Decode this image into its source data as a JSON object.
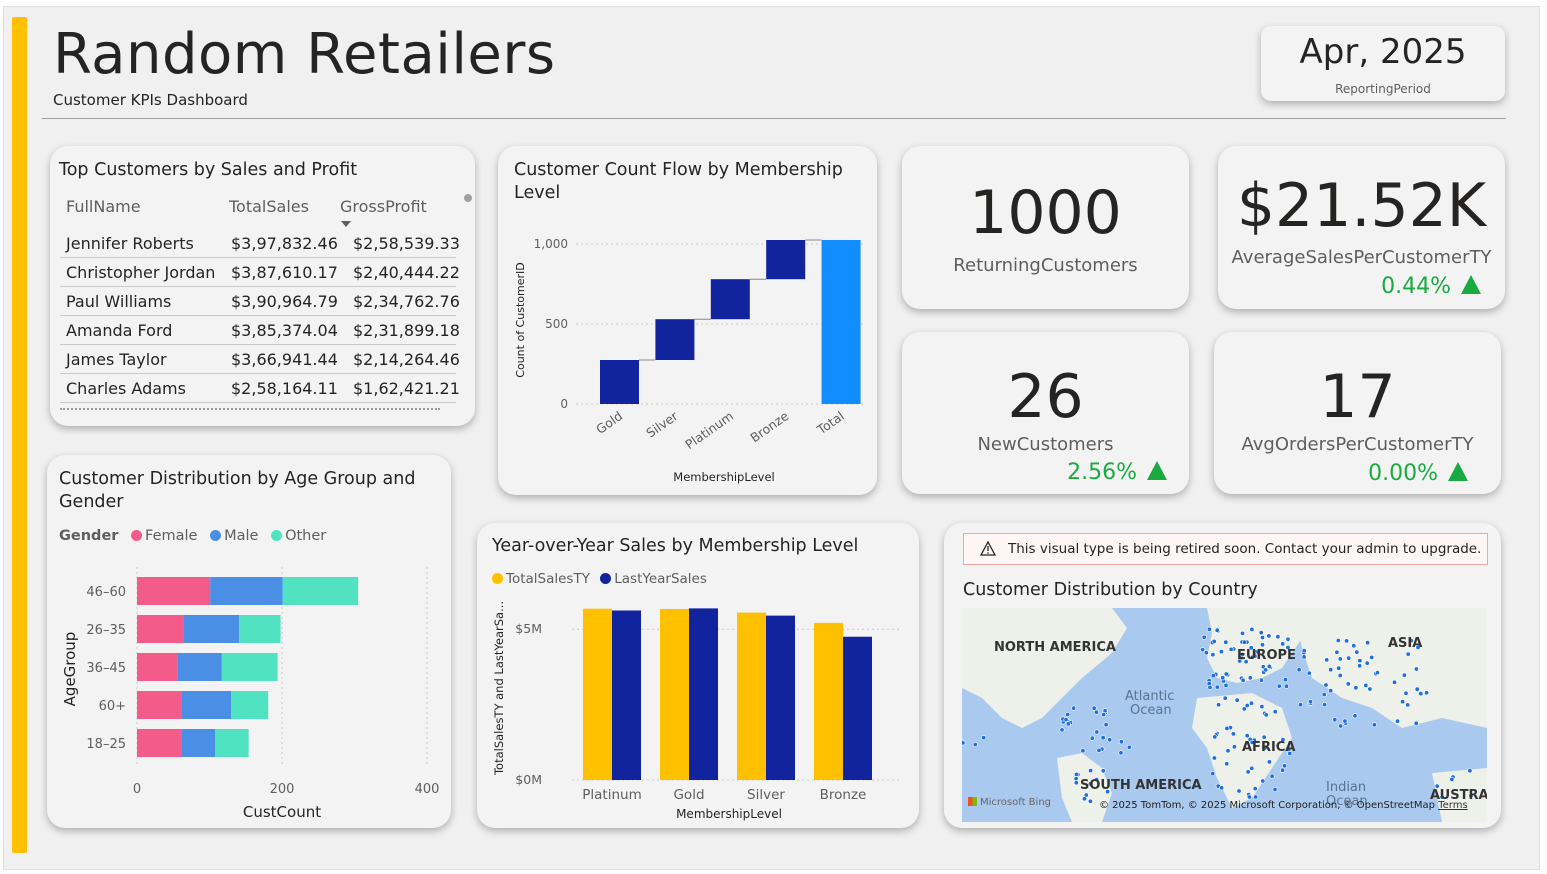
{
  "header": {
    "title": "Random Retailers",
    "subtitle": "Customer KPIs Dashboard",
    "period_value": "Apr, 2025",
    "period_label": "ReportingPeriod",
    "accent_color": "#ffc000"
  },
  "top_customers": {
    "title": "Top Customers by Sales and Profit",
    "columns": [
      "FullName",
      "TotalSales",
      "GrossProfit"
    ],
    "sort_indicator": "GrossProfit descending",
    "rows": [
      [
        "Jennifer Roberts",
        "$3,97,832.46",
        "$2,58,539.33"
      ],
      [
        "Christopher Jordan",
        "$3,87,610.17",
        "$2,40,444.22"
      ],
      [
        "Paul Williams",
        "$3,90,964.79",
        "$2,34,762.76"
      ],
      [
        "Amanda Ford",
        "$3,85,374.04",
        "$2,31,899.18"
      ],
      [
        "James Taylor",
        "$3,66,941.44",
        "$2,14,264.46"
      ],
      [
        "Charles Adams",
        "$2,58,164.11",
        "$1,62,421.21"
      ]
    ]
  },
  "kpis": {
    "returning": {
      "value": "1000",
      "label": "ReturningCustomers"
    },
    "avg_sales": {
      "value": "$21.52K",
      "label": "AverageSalesPerCustomerTY",
      "delta": "0.44%"
    },
    "new_customers": {
      "value": "26",
      "label": "NewCustomers",
      "delta": "2.56%"
    },
    "avg_orders": {
      "value": "17",
      "label": "AvgOrdersPerCustomerTY",
      "delta": "0.00%"
    },
    "positive_color": "#1aab40"
  },
  "chart_data": [
    {
      "id": "flow",
      "type": "bar",
      "subtype": "waterfall",
      "title": "Customer Count Flow by Membership Level",
      "xlabel": "MembershipLevel",
      "ylabel": "Count of CustomerID",
      "categories": [
        "Gold",
        "Silver",
        "Platinum",
        "Bronze",
        "Total"
      ],
      "values": [
        275,
        255,
        250,
        245,
        1025
      ],
      "ylim": [
        0,
        1050
      ],
      "yticks": [
        "0",
        "500",
        "1,000"
      ],
      "colors": {
        "step": "#12239e",
        "total": "#118dff"
      },
      "grid": true
    },
    {
      "id": "age",
      "type": "bar",
      "orientation": "horizontal",
      "stacked": true,
      "title": "Customer Distribution by Age Group and Gender",
      "legend_title": "Gender",
      "xlabel": "CustCount",
      "ylabel": "AgeGroup",
      "categories": [
        "46–60",
        "26–35",
        "36–45",
        "60+",
        "18–25"
      ],
      "series": [
        {
          "name": "Female",
          "color": "#f35c8a",
          "values": [
            101,
            64,
            56,
            62,
            62
          ]
        },
        {
          "name": "Male",
          "color": "#4a8ee6",
          "values": [
            100,
            77,
            61,
            68,
            46
          ]
        },
        {
          "name": "Other",
          "color": "#51e3c1",
          "values": [
            104,
            57,
            77,
            51,
            46
          ]
        }
      ],
      "xlim": [
        0,
        400
      ],
      "xticks": [
        "0",
        "200",
        "400"
      ]
    },
    {
      "id": "yoy",
      "type": "bar",
      "title": "Year-over-Year Sales by Membership Level",
      "xlabel": "MembershipLevel",
      "ylabel": "TotalSalesTY and LastYearSa...",
      "categories": [
        "Platinum",
        "Gold",
        "Silver",
        "Bronze"
      ],
      "series": [
        {
          "name": "TotalSalesTY",
          "color": "#ffc000",
          "values": [
            5.68,
            5.67,
            5.55,
            5.21
          ]
        },
        {
          "name": "LastYearSales",
          "color": "#12239e",
          "values": [
            5.62,
            5.69,
            5.45,
            4.75
          ]
        }
      ],
      "ylim": [
        0,
        6.2
      ],
      "yticks": [
        "$0M",
        "$5M"
      ],
      "grid": true
    }
  ],
  "map": {
    "warning": "This visual type is being retired soon. Contact your admin to upgrade.",
    "title": "Customer Distribution by Country",
    "labels": [
      "NORTH AMERICA",
      "EUROPE",
      "ASIA",
      "Atlantic",
      "Ocean",
      "AFRICA",
      "SOUTH AMERICA",
      "Indian",
      "Ocean",
      "AUSTRAL"
    ],
    "attribution": "© 2025 TomTom, © 2025 Microsoft Corporation, © OpenStreetMap",
    "terms": "Terms",
    "provider": "Microsoft Bing"
  }
}
